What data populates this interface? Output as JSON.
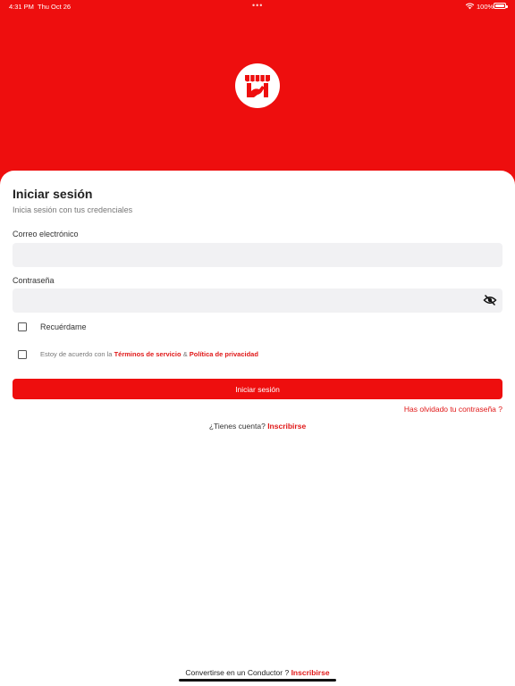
{
  "status_bar": {
    "time": "4:31 PM",
    "date": "Thu Oct 26",
    "battery": "100%",
    "wifi_icon": "wifi-icon",
    "battery_icon": "battery-icon"
  },
  "brand": {
    "primary_color": "#ee0e0e",
    "link_color": "#e01818",
    "logo_icon": "storefront-icon"
  },
  "login": {
    "title": "Iniciar sesión",
    "subtitle": "Inicia sesión con tus credenciales",
    "email_label": "Correo electrónico",
    "email_value": "",
    "password_label": "Contraseña",
    "password_value": "",
    "password_toggle_icon": "eye-off-icon",
    "remember_label": "Recuérdame",
    "remember_checked": false,
    "terms_prefix": "Estoy de acuerdo con la",
    "terms_link": "Términos de servicio",
    "terms_and": "&",
    "privacy_link": "Política de privacidad",
    "terms_checked": false,
    "submit_label": "Iniciar sesión",
    "forgot_label": "Has olvidado tu contraseña ?",
    "no_account_text": "¿Tienes cuenta?",
    "signup_link": "Inscribirse"
  },
  "driver": {
    "text": "Convertirse en un Conductor ?",
    "signup_link": "Inscribirse"
  }
}
